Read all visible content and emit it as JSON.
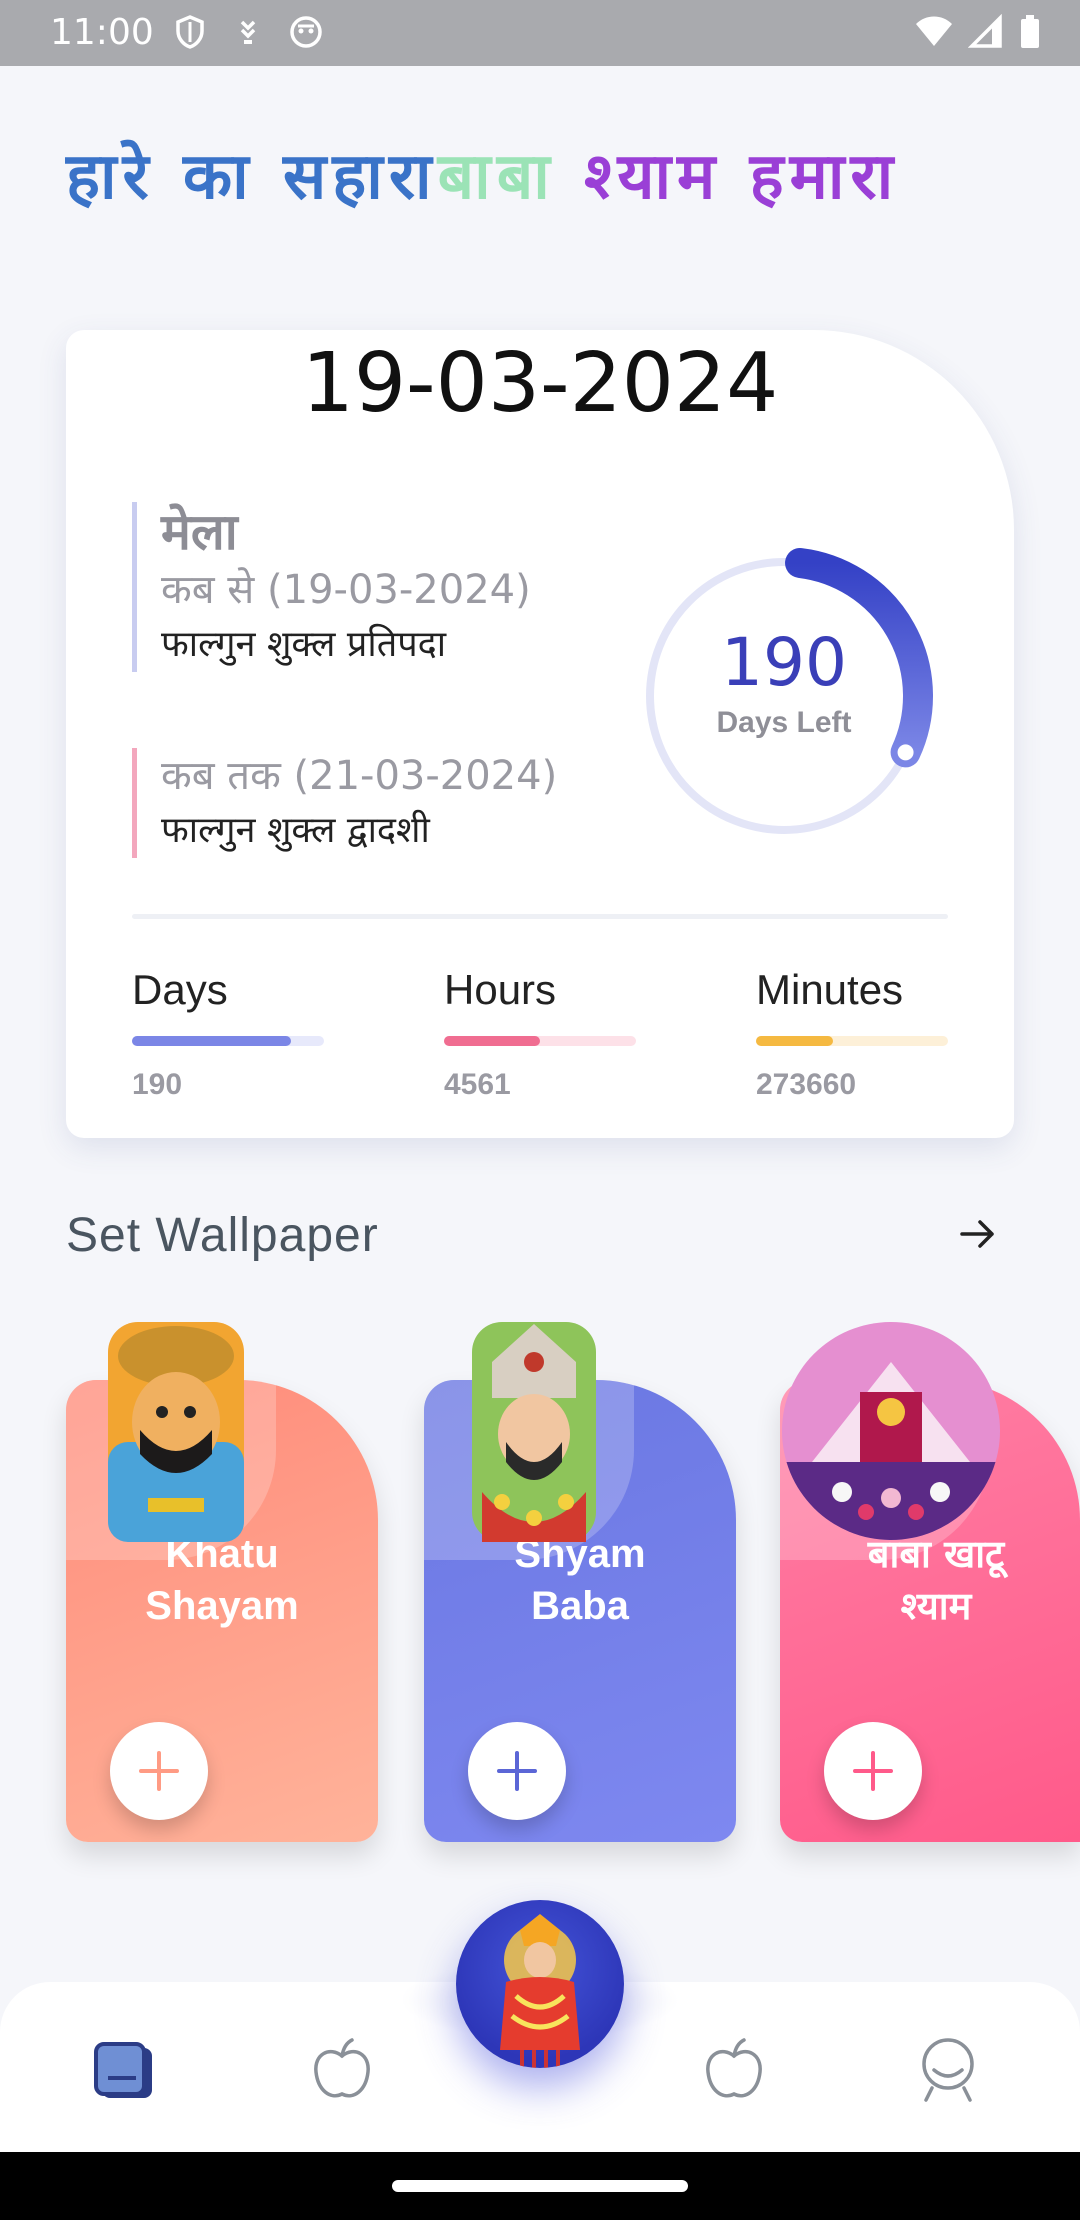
{
  "status_bar": {
    "time": "11:00",
    "icons_left": [
      "shield-icon",
      "download-icon",
      "android-icon"
    ],
    "icons_right": [
      "wifi-icon",
      "signal-icon",
      "battery-icon"
    ]
  },
  "header": {
    "title_part1": "हारे का सहारा",
    "title_part2": "बाबा",
    "title_part3": " श्याम हमारा",
    "colors": {
      "part1": "#3a73c8",
      "part2": "#9be3b6",
      "part3": "#9a3fd6"
    }
  },
  "countdown_card": {
    "date": "19-03-2024",
    "event": {
      "title": "मेला",
      "from_label": "कब से (19-03-2024)",
      "from_tithi": "फाल्गुन शुक्ल प्रतिपदा",
      "to_label": "कब तक (21-03-2024)",
      "to_tithi": "फाल्गुन शुक्ल द्वादशी"
    },
    "ring": {
      "value": "190",
      "label": "Days Left",
      "progress_fraction": 0.3
    },
    "stats": [
      {
        "label": "Days",
        "value": "190",
        "progress": 0.83,
        "color": "#7b86e6",
        "track": "#e7e9fb"
      },
      {
        "label": "Hours",
        "value": "4561",
        "progress": 0.5,
        "color": "#f06d91",
        "track": "#fde1e8"
      },
      {
        "label": "Minutes",
        "value": "273660",
        "progress": 0.4,
        "color": "#f5b941",
        "track": "#fdf0d8"
      }
    ]
  },
  "wallpaper": {
    "section_title": "Set Wallpaper",
    "arrow_icon": "arrow-right-icon",
    "cards": [
      {
        "name_line1": "Khatu",
        "name_line2": "Shayam",
        "plus_color": "#ff9b84"
      },
      {
        "name_line1": "Shyam",
        "name_line2": "Baba",
        "plus_color": "#5b66d6"
      },
      {
        "name_line1": "बाबा खाटू",
        "name_line2": "श्याम",
        "plus_color": "#ff5a8a"
      }
    ]
  },
  "bottom_nav": {
    "items": [
      "book-icon",
      "apple-icon",
      "center-deity-icon",
      "apple-icon",
      "profile-icon"
    ],
    "active": "book-icon"
  }
}
